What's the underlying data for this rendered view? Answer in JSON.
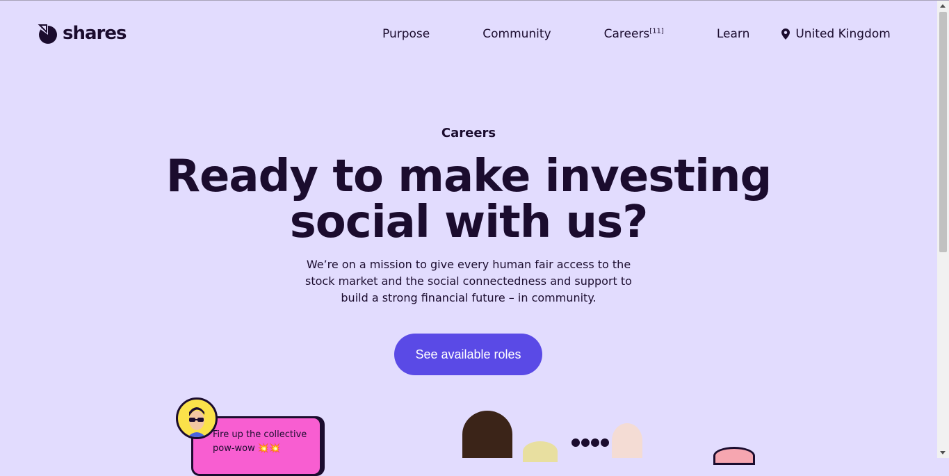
{
  "brand": {
    "name": "shares"
  },
  "nav": {
    "items": [
      {
        "label": "Purpose"
      },
      {
        "label": "Community"
      },
      {
        "label": "Careers",
        "badge": "[11]"
      },
      {
        "label": "Learn"
      }
    ],
    "country": "United Kingdom"
  },
  "hero": {
    "eyebrow": "Careers",
    "headline_line1": "Ready to make investing",
    "headline_line2": "social with us?",
    "description": "We’re on a mission to give every human fair access to the stock market and the social connectedness and support to build a strong financial future – in community.",
    "cta_label": "See available roles"
  },
  "card": {
    "text": "Fire up the collective pow-wow 💥💥"
  },
  "colors": {
    "background": "#e2dcfe",
    "accent": "#5a4ae6",
    "card": "#f85ed1",
    "text": "#1b0c2e"
  }
}
